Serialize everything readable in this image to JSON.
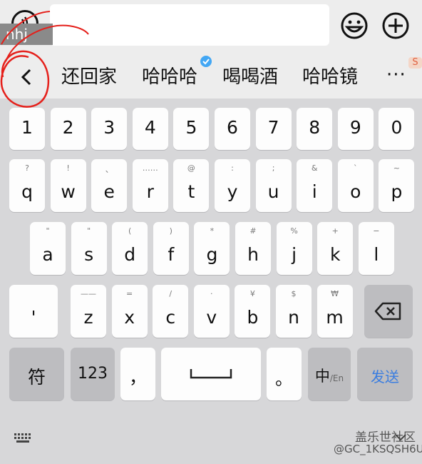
{
  "composing_text": "nhj",
  "candidates": [
    "还回家",
    "哈哈哈",
    "喝喝酒",
    "哈哈镜"
  ],
  "candidates_more": "···",
  "numbers": [
    "1",
    "2",
    "3",
    "4",
    "5",
    "6",
    "7",
    "8",
    "9",
    "0"
  ],
  "row_q": [
    {
      "main": "q",
      "sub": "?"
    },
    {
      "main": "w",
      "sub": "!"
    },
    {
      "main": "e",
      "sub": "、"
    },
    {
      "main": "r",
      "sub": "……"
    },
    {
      "main": "t",
      "sub": "@"
    },
    {
      "main": "y",
      "sub": ":"
    },
    {
      "main": "u",
      "sub": ";"
    },
    {
      "main": "i",
      "sub": "&"
    },
    {
      "main": "o",
      "sub": "`"
    },
    {
      "main": "p",
      "sub": "~"
    }
  ],
  "row_a": [
    {
      "main": "a",
      "sub": "\""
    },
    {
      "main": "s",
      "sub": "\""
    },
    {
      "main": "d",
      "sub": "("
    },
    {
      "main": "f",
      "sub": ")"
    },
    {
      "main": "g",
      "sub": "*"
    },
    {
      "main": "h",
      "sub": "#"
    },
    {
      "main": "j",
      "sub": "%"
    },
    {
      "main": "k",
      "sub": "+"
    },
    {
      "main": "l",
      "sub": "−"
    }
  ],
  "row_z": [
    {
      "main": "'",
      "sub": ""
    },
    {
      "main": "z",
      "sub": "——"
    },
    {
      "main": "x",
      "sub": "="
    },
    {
      "main": "c",
      "sub": "/"
    },
    {
      "main": "v",
      "sub": "·"
    },
    {
      "main": "b",
      "sub": "¥"
    },
    {
      "main": "n",
      "sub": "$"
    },
    {
      "main": "m",
      "sub": "₩"
    }
  ],
  "bottom": {
    "symbols": "符",
    "numeric": "123",
    "comma": "，",
    "period": "。",
    "lang_main": "中",
    "lang_sub": "/En",
    "send": "发送"
  },
  "watermark": "盖乐世社区",
  "watermark_handle": "@GC_1KSQSH6U",
  "colors": {
    "send": "#3a7de0",
    "annotation": "#e5201b",
    "check": "#43a7f4"
  }
}
